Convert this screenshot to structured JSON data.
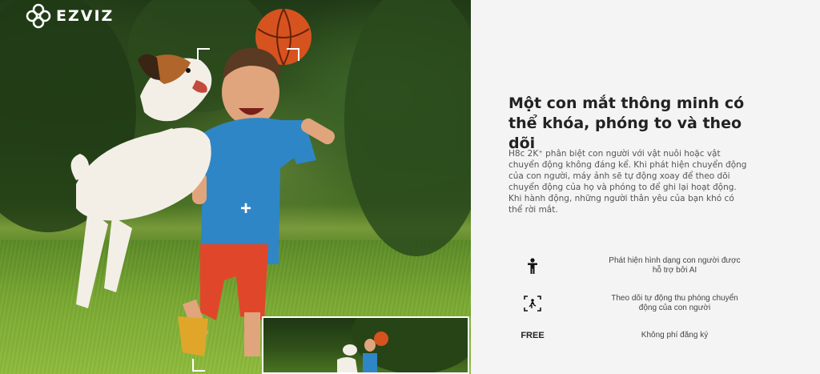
{
  "brand": {
    "name": "EZVIZ"
  },
  "hero": {
    "headline": "Một con mắt thông minh có thể khóa, phóng to và theo dõi",
    "description": "H8c 2K⁺ phân biệt con người với vật nuôi hoặc vật chuyển động không đáng kể. Khi phát hiện chuyển động của con người, máy ảnh sẽ tự động xoay để theo dõi chuyển động của họ và phóng to để ghi lại hoạt động. Khi hành động, những người thân yêu của bạn khó có thể rời mắt."
  },
  "features": [
    {
      "icon": "person-icon",
      "label": "Phát hiện hình dạng con người được hỗ trợ bởi AI"
    },
    {
      "icon": "motion-tracking-icon",
      "label": "Theo dõi tự động thu phóng chuyển động của con người"
    },
    {
      "icon": "free-badge",
      "badge": "FREE",
      "label": "Không phí đăng ký"
    }
  ],
  "colors": {
    "panel_bg": "#f4f4f4",
    "headline": "#222222",
    "body": "#555555"
  }
}
